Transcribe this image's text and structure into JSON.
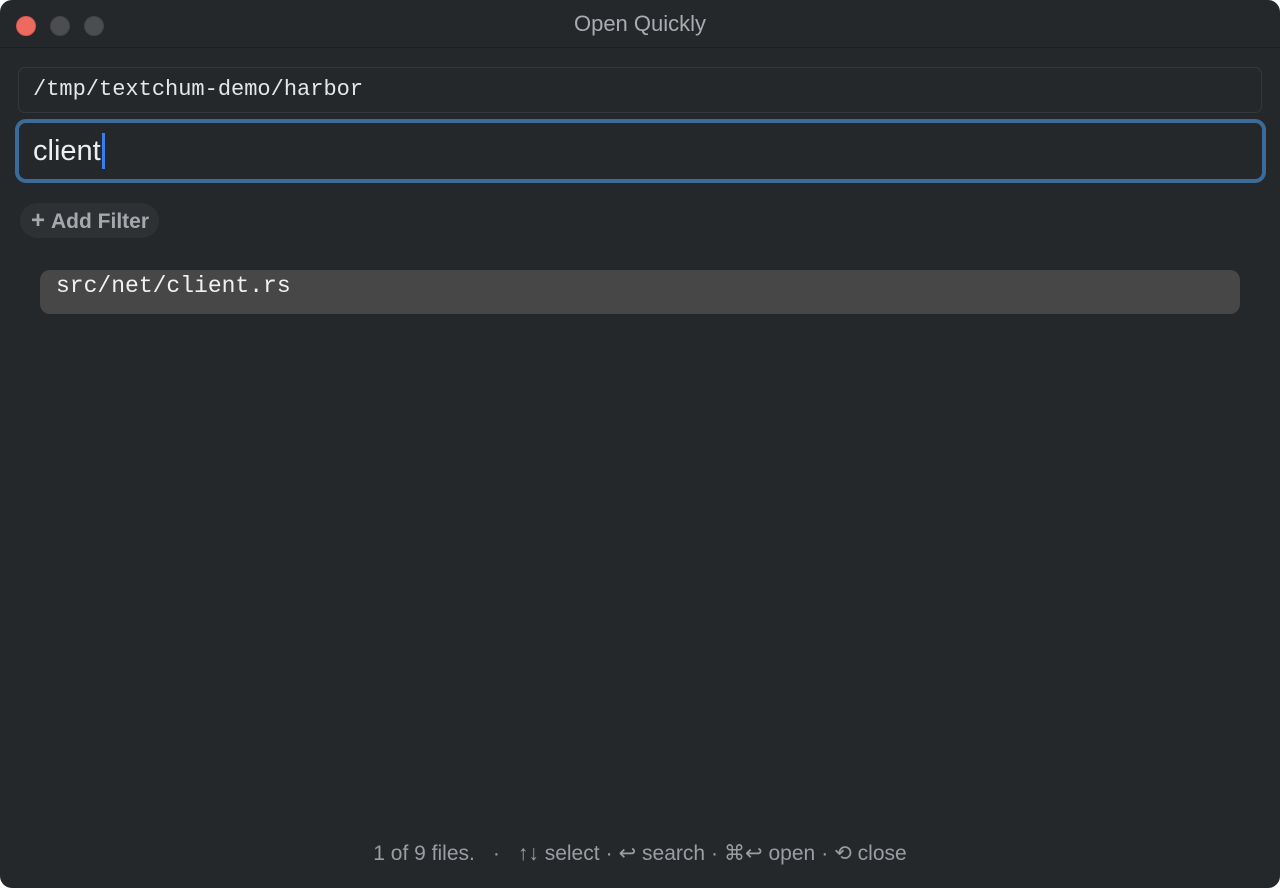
{
  "window": {
    "title": "Open Quickly"
  },
  "path_field": {
    "value": "/tmp/textchum-demo/harbor"
  },
  "search": {
    "value": "client"
  },
  "add_filter": {
    "icon": "plus-icon",
    "label": "Add Filter"
  },
  "results": [
    {
      "path": "src/net/client.rs",
      "selected": true
    }
  ],
  "status": {
    "count": "1 of 9 files.",
    "select_keys": "↑↓",
    "select_label": "select",
    "search_key": "↩",
    "search_label": "search",
    "open_keys": "⌘↩",
    "open_label": "open",
    "close_key": "⟲",
    "close_label": "close"
  },
  "colors": {
    "window_bg": "#25282b",
    "focus_ring": "#3b6b99",
    "caret": "#3a7bf0",
    "selected_row": "#474747",
    "close_button": "#ed6a5e"
  }
}
